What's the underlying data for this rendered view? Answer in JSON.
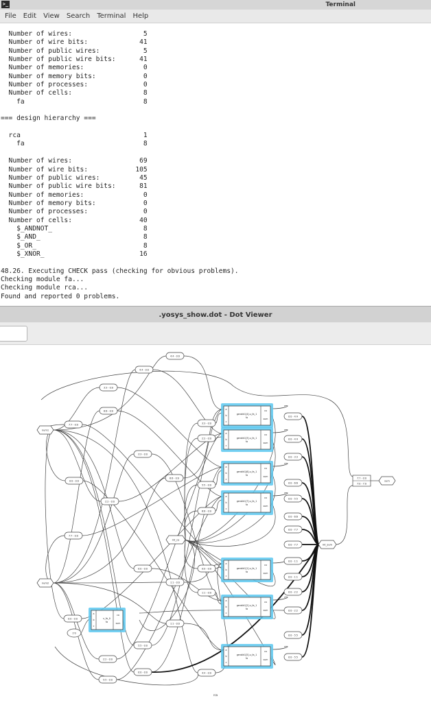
{
  "terminal": {
    "title": "Terminal",
    "icon": "terminal-icon",
    "menu": [
      "File",
      "Edit",
      "View",
      "Search",
      "Terminal",
      "Help"
    ],
    "lines": [
      "  Number of wires:                  5",
      "  Number of wire bits:             41",
      "  Number of public wires:           5",
      "  Number of public wire bits:      41",
      "  Number of memories:               0",
      "  Number of memory bits:            0",
      "  Number of processes:              0",
      "  Number of cells:                  8",
      "    fa                              8",
      "",
      "=== design hierarchy ===",
      "",
      "  rca                               1",
      "    fa                              8",
      "",
      "  Number of wires:                 69",
      "  Number of wire bits:            105",
      "  Number of public wires:          45",
      "  Number of public wire bits:      81",
      "  Number of memories:               0",
      "  Number of memory bits:            0",
      "  Number of processes:              0",
      "  Number of cells:                 40",
      "    $_ANDNOT_                       8",
      "    $_AND_                          8",
      "    $_OR_                           8",
      "    $_XNOR_                        16",
      "",
      "48.26. Executing CHECK pass (checking for obvious problems).",
      "Checking module fa...",
      "Checking module rca...",
      "Found and reported 0 problems."
    ]
  },
  "dot_viewer": {
    "title": ".yosys_show.dot - Dot Viewer",
    "footer_label": "rca",
    "inputs": [
      "num1",
      "num2",
      "1'0"
    ],
    "outputs": [
      "sum"
    ],
    "hubs": [
      "int_co",
      "int_sum"
    ],
    "top_slices": [
      "4:4 - 0:0",
      "4:4 - 0:0",
      "3:3 - 0:0",
      "6:6 - 0:0",
      "7:7 - 0:0",
      "3:3 - 0:0",
      "0:0 - 0:0",
      "6:6 - 0:0",
      "2:2 - 0:0",
      "7:7 - 0:0",
      "0:0 - 0:0",
      "1:1 - 0:0",
      "0:0 - 0:0",
      "1:1 - 0:0",
      "5:5 - 0:0",
      "2:2 - 0:0",
      "0:0 - 0:0",
      "5:5 - 0:0",
      "4:4 - 0:0"
    ],
    "mid_slices": [
      "3:3 - 0:0",
      "2:2 - 0:0",
      "5:5 - 0:0",
      "6:6 - 0:0",
      "0:0 - 0:0",
      "1:1 - 0:0"
    ],
    "right_slices": [
      "0:0 - 4:4",
      "0:0 - 4:4",
      "0:0 - 3:3",
      "0:0 - 6:6",
      "0:0 - 5:5",
      "0:0 - 6:6",
      "0:0 - 7:7",
      "0:0 - 7:7",
      "0:0 - 1:1",
      "0:0 - 1:1",
      "0:0 - 2:2",
      "0:0 - 2:2",
      "0:0 - 5:5",
      "0:0 - 5:5"
    ],
    "concat": [
      "7:7 - 0:0",
      "7:0 - 7:0"
    ],
    "cells": [
      {
        "name": "genblk1[4].u_fa_1",
        "type": "fa"
      },
      {
        "name": "genblk1[3].u_fa_1",
        "type": "fa"
      },
      {
        "name": "genblk1[6].u_fa_1",
        "type": "fa"
      },
      {
        "name": "genblk1[7].u_fa_1",
        "type": "fa"
      },
      {
        "name": "genblk1[1].u_fa_1",
        "type": "fa"
      },
      {
        "name": "genblk1[2].u_fa_1",
        "type": "fa"
      },
      {
        "name": "genblk1[5].u_fa_1",
        "type": "fa"
      },
      {
        "name": "u_fa_0",
        "type": "fa"
      }
    ],
    "ports_in": [
      "a",
      "b",
      "c"
    ],
    "ports_out": [
      "co",
      "sum"
    ],
    "colors": {
      "highlight": "#5cc8f0",
      "edge": "#444444",
      "bold_edge": "#111111"
    }
  }
}
